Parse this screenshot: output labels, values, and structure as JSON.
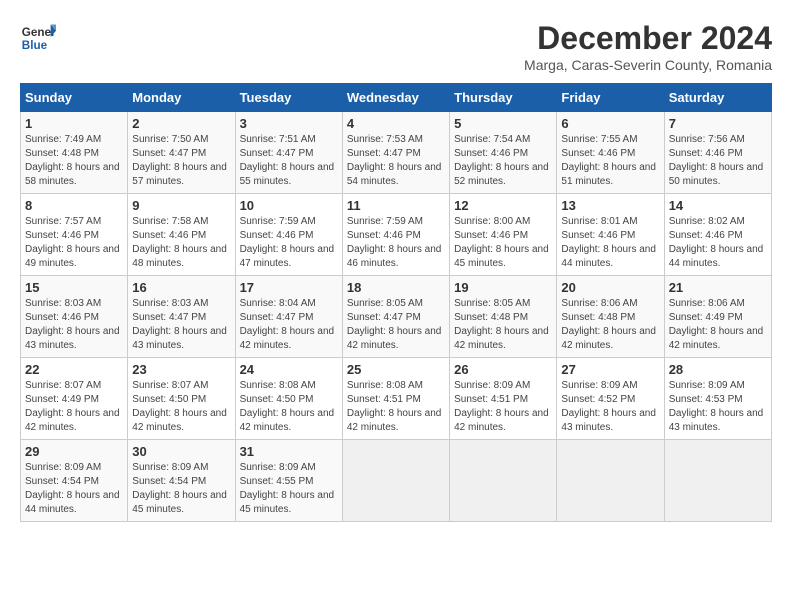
{
  "header": {
    "logo_line1": "General",
    "logo_line2": "Blue",
    "title": "December 2024",
    "subtitle": "Marga, Caras-Severin County, Romania"
  },
  "calendar": {
    "days_of_week": [
      "Sunday",
      "Monday",
      "Tuesday",
      "Wednesday",
      "Thursday",
      "Friday",
      "Saturday"
    ],
    "weeks": [
      [
        {
          "num": "1",
          "sunrise": "7:49 AM",
          "sunset": "4:48 PM",
          "daylight": "8 hours and 58 minutes."
        },
        {
          "num": "2",
          "sunrise": "7:50 AM",
          "sunset": "4:47 PM",
          "daylight": "8 hours and 57 minutes."
        },
        {
          "num": "3",
          "sunrise": "7:51 AM",
          "sunset": "4:47 PM",
          "daylight": "8 hours and 55 minutes."
        },
        {
          "num": "4",
          "sunrise": "7:53 AM",
          "sunset": "4:47 PM",
          "daylight": "8 hours and 54 minutes."
        },
        {
          "num": "5",
          "sunrise": "7:54 AM",
          "sunset": "4:46 PM",
          "daylight": "8 hours and 52 minutes."
        },
        {
          "num": "6",
          "sunrise": "7:55 AM",
          "sunset": "4:46 PM",
          "daylight": "8 hours and 51 minutes."
        },
        {
          "num": "7",
          "sunrise": "7:56 AM",
          "sunset": "4:46 PM",
          "daylight": "8 hours and 50 minutes."
        }
      ],
      [
        {
          "num": "8",
          "sunrise": "7:57 AM",
          "sunset": "4:46 PM",
          "daylight": "8 hours and 49 minutes."
        },
        {
          "num": "9",
          "sunrise": "7:58 AM",
          "sunset": "4:46 PM",
          "daylight": "8 hours and 48 minutes."
        },
        {
          "num": "10",
          "sunrise": "7:59 AM",
          "sunset": "4:46 PM",
          "daylight": "8 hours and 47 minutes."
        },
        {
          "num": "11",
          "sunrise": "7:59 AM",
          "sunset": "4:46 PM",
          "daylight": "8 hours and 46 minutes."
        },
        {
          "num": "12",
          "sunrise": "8:00 AM",
          "sunset": "4:46 PM",
          "daylight": "8 hours and 45 minutes."
        },
        {
          "num": "13",
          "sunrise": "8:01 AM",
          "sunset": "4:46 PM",
          "daylight": "8 hours and 44 minutes."
        },
        {
          "num": "14",
          "sunrise": "8:02 AM",
          "sunset": "4:46 PM",
          "daylight": "8 hours and 44 minutes."
        }
      ],
      [
        {
          "num": "15",
          "sunrise": "8:03 AM",
          "sunset": "4:46 PM",
          "daylight": "8 hours and 43 minutes."
        },
        {
          "num": "16",
          "sunrise": "8:03 AM",
          "sunset": "4:47 PM",
          "daylight": "8 hours and 43 minutes."
        },
        {
          "num": "17",
          "sunrise": "8:04 AM",
          "sunset": "4:47 PM",
          "daylight": "8 hours and 42 minutes."
        },
        {
          "num": "18",
          "sunrise": "8:05 AM",
          "sunset": "4:47 PM",
          "daylight": "8 hours and 42 minutes."
        },
        {
          "num": "19",
          "sunrise": "8:05 AM",
          "sunset": "4:48 PM",
          "daylight": "8 hours and 42 minutes."
        },
        {
          "num": "20",
          "sunrise": "8:06 AM",
          "sunset": "4:48 PM",
          "daylight": "8 hours and 42 minutes."
        },
        {
          "num": "21",
          "sunrise": "8:06 AM",
          "sunset": "4:49 PM",
          "daylight": "8 hours and 42 minutes."
        }
      ],
      [
        {
          "num": "22",
          "sunrise": "8:07 AM",
          "sunset": "4:49 PM",
          "daylight": "8 hours and 42 minutes."
        },
        {
          "num": "23",
          "sunrise": "8:07 AM",
          "sunset": "4:50 PM",
          "daylight": "8 hours and 42 minutes."
        },
        {
          "num": "24",
          "sunrise": "8:08 AM",
          "sunset": "4:50 PM",
          "daylight": "8 hours and 42 minutes."
        },
        {
          "num": "25",
          "sunrise": "8:08 AM",
          "sunset": "4:51 PM",
          "daylight": "8 hours and 42 minutes."
        },
        {
          "num": "26",
          "sunrise": "8:09 AM",
          "sunset": "4:51 PM",
          "daylight": "8 hours and 42 minutes."
        },
        {
          "num": "27",
          "sunrise": "8:09 AM",
          "sunset": "4:52 PM",
          "daylight": "8 hours and 43 minutes."
        },
        {
          "num": "28",
          "sunrise": "8:09 AM",
          "sunset": "4:53 PM",
          "daylight": "8 hours and 43 minutes."
        }
      ],
      [
        {
          "num": "29",
          "sunrise": "8:09 AM",
          "sunset": "4:54 PM",
          "daylight": "8 hours and 44 minutes."
        },
        {
          "num": "30",
          "sunrise": "8:09 AM",
          "sunset": "4:54 PM",
          "daylight": "8 hours and 45 minutes."
        },
        {
          "num": "31",
          "sunrise": "8:09 AM",
          "sunset": "4:55 PM",
          "daylight": "8 hours and 45 minutes."
        },
        null,
        null,
        null,
        null
      ]
    ]
  }
}
